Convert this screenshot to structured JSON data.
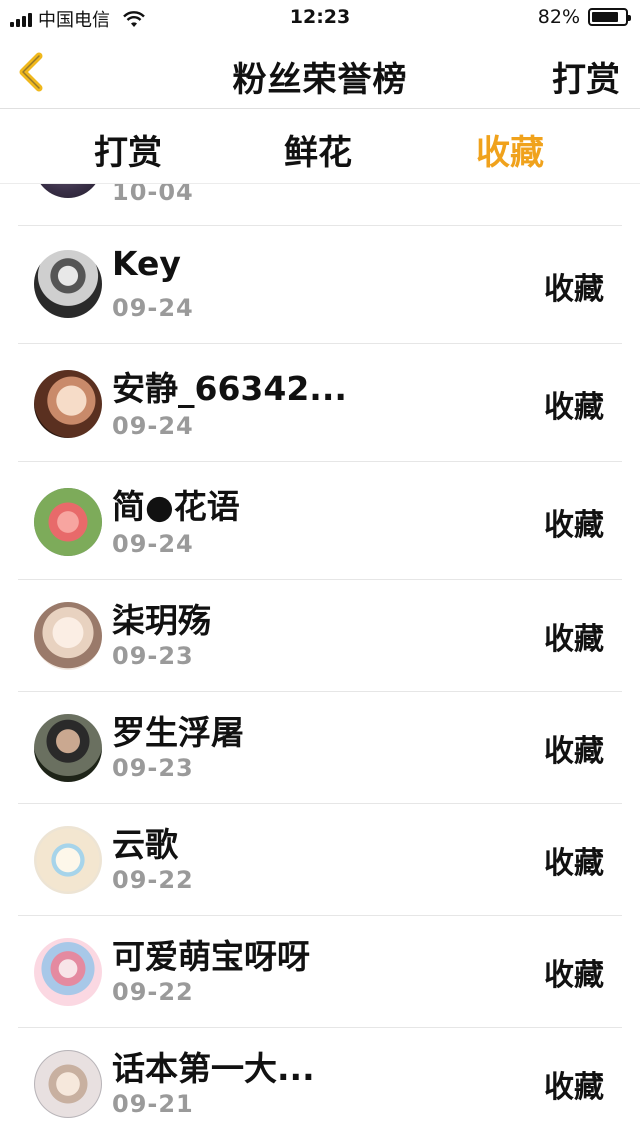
{
  "status_bar": {
    "carrier": "中国电信",
    "time": "12:23",
    "battery": "82%",
    "battery_level": 0.82,
    "signal_icon": "signal-bars-icon",
    "wifi_icon": "wifi-icon",
    "battery_icon": "battery-icon"
  },
  "nav": {
    "back_icon": "chevron-left-icon",
    "back_color": "#f0b81c",
    "title": "粉丝荣誉榜",
    "action": "打赏"
  },
  "tabs": [
    {
      "label": "打赏",
      "active": false
    },
    {
      "label": "鲜花",
      "active": false
    },
    {
      "label": "收藏",
      "active": true
    }
  ],
  "accent_color": "#f0a21c",
  "list": [
    {
      "name": "",
      "date": "10-04",
      "type": ""
    },
    {
      "name": "Key",
      "date": "09-24",
      "type": "收藏"
    },
    {
      "name": "安静_66342...",
      "date": "09-24",
      "type": "收藏"
    },
    {
      "name": "简●花语",
      "date": "09-24",
      "type": "收藏"
    },
    {
      "name": "柒玥殇",
      "date": "09-23",
      "type": "收藏"
    },
    {
      "name": "罗生浮屠",
      "date": "09-23",
      "type": "收藏"
    },
    {
      "name": "云歌",
      "date": "09-22",
      "type": "收藏"
    },
    {
      "name": "可爱萌宝呀呀",
      "date": "09-22",
      "type": "收藏"
    },
    {
      "name": "话本第一大...",
      "date": "09-21",
      "type": "收藏"
    }
  ]
}
